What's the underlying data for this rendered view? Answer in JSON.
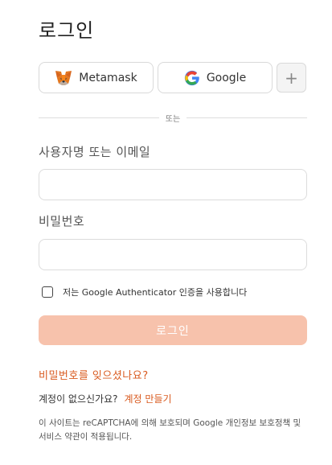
{
  "page": {
    "title": "로그인"
  },
  "social": {
    "metamask": {
      "label": "Metamask",
      "icon": "metamask-fox-icon"
    },
    "google": {
      "label": "Google",
      "icon": "google-logo-icon"
    },
    "more": {
      "label": "+",
      "icon": "plus-icon"
    }
  },
  "divider": {
    "text": "또는"
  },
  "form": {
    "username_label": "사용자명 또는 이메일",
    "username_value": "",
    "password_label": "비밀번호",
    "password_value": "",
    "authenticator_label": "저는 Google Authenticator 인증을 사용합니다",
    "authenticator_checked": false,
    "submit_label": "로그인"
  },
  "links": {
    "forgot": "비밀번호를 잊으셨나요?",
    "no_account": "계정이 없으신가요?",
    "signup": "계정 만들기"
  },
  "notice": "이 사이트는 reCAPTCHA에 의해 보호되며 Google 개인정보 보호정책 및 서비스 약관이 적용됩니다.",
  "colors": {
    "accent": "#d95a1f",
    "button_disabled": "#f7c2ac",
    "border": "#dcdcdc"
  }
}
